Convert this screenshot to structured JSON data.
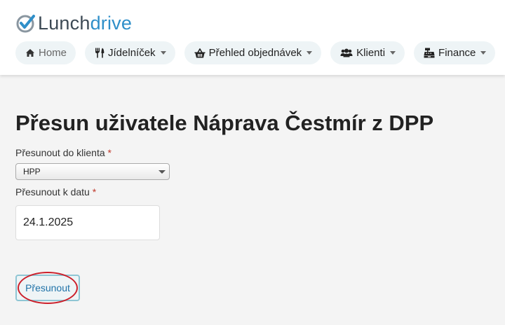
{
  "brand": {
    "logo_part1": "Lunch",
    "logo_part2": "drive",
    "color_text": "#3d4a55",
    "color_accent": "#2f8fc9"
  },
  "nav": {
    "items": [
      {
        "label": "Home",
        "icon": "home-icon",
        "dropdown": false
      },
      {
        "label": "Jídelníček",
        "icon": "utensils-icon",
        "dropdown": true
      },
      {
        "label": "Přehled objednávek",
        "icon": "basket-icon",
        "dropdown": true
      },
      {
        "label": "Klienti",
        "icon": "users-icon",
        "dropdown": true
      },
      {
        "label": "Finance",
        "icon": "cash-register-icon",
        "dropdown": true
      }
    ]
  },
  "page": {
    "title": "Přesun uživatele Náprava Čestmír z DPP"
  },
  "form": {
    "client_label": "Přesunout do klienta",
    "client_required_mark": "*",
    "client_selected": "HPP",
    "date_label": "Přesunout k datu",
    "date_required_mark": "*",
    "date_value": "24.1.2025",
    "submit_label": "Přesunout"
  },
  "colors": {
    "required": "#c0392b",
    "button_text": "#1f72a8",
    "button_border": "#8fc6d4",
    "annotation": "#cc1f2a"
  }
}
